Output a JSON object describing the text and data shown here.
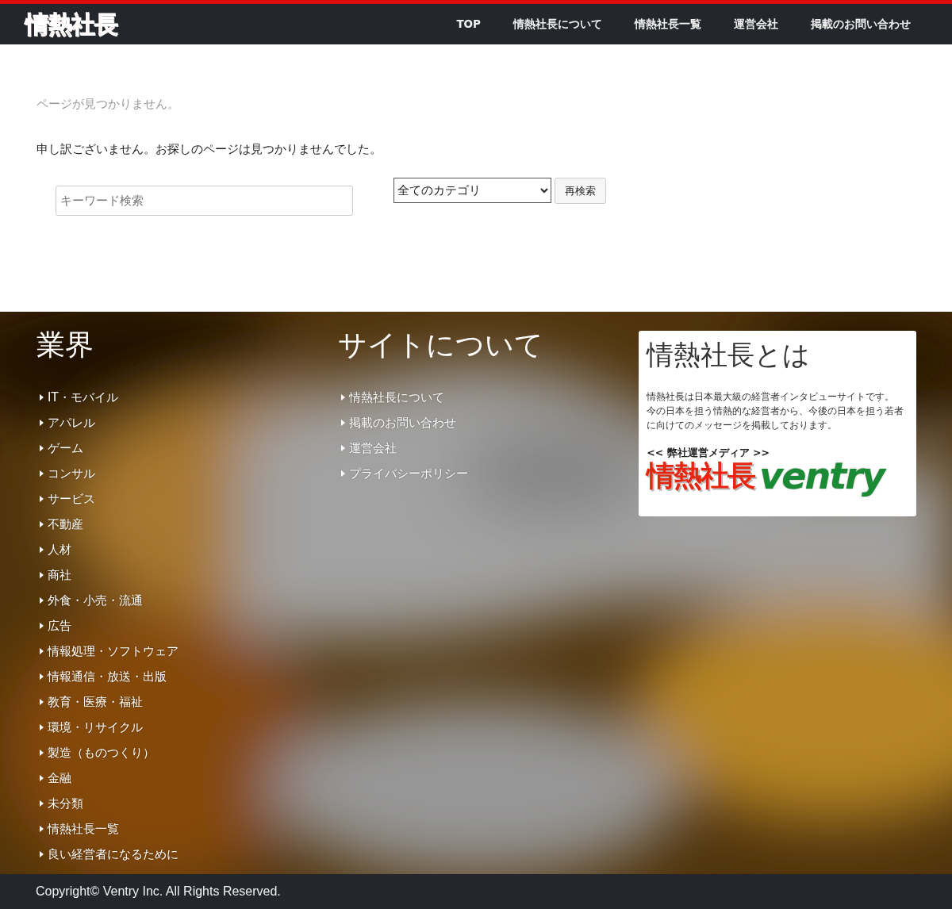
{
  "header": {
    "logo": "情熱社長",
    "nav": [
      {
        "label": "TOP"
      },
      {
        "label": "情熱社長について"
      },
      {
        "label": "情熱社長一覧"
      },
      {
        "label": "運営会社"
      },
      {
        "label": "掲載のお問い合わせ"
      }
    ]
  },
  "main": {
    "title": "ページが見つかりません。",
    "message": "申し訳ございません。お探しのページは見つかりませんでした。",
    "search": {
      "placeholder": "キーワード検索",
      "category": "全てのカテゴリ",
      "button": "再検索"
    }
  },
  "footer": {
    "columns": [
      {
        "heading": "業界",
        "links": [
          "IT・モバイル",
          "アパレル",
          "ゲーム",
          "コンサル",
          "サービス",
          "不動産",
          "人材",
          "商社",
          "外食・小売・流通",
          "広告",
          "情報処理・ソフトウェア",
          "情報通信・放送・出版",
          "教育・医療・福祉",
          "環境・リサイクル",
          "製造（ものつくり）",
          "金融",
          "未分類",
          "情熱社長一覧",
          "良い経営者になるために"
        ]
      },
      {
        "heading": "サイトについて",
        "links": [
          "情熱社長について",
          "掲載のお問い合わせ",
          "運営会社",
          "プライバシーポリシー"
        ]
      }
    ],
    "about": {
      "heading": "情熱社長とは",
      "paragraphs": [
        "情熱社長は日本最大級の経営者インタビューサイトです。",
        "今の日本を担う情熱的な経営者から、今後の日本を担う若者に向けてのメッセージを掲載しております。"
      ],
      "media_label": "<< 弊社運営メディア >>",
      "logos": [
        "情熱社長",
        "ventry"
      ]
    }
  },
  "copyright": "Copyright© Ventry Inc. All Rights Reserved."
}
